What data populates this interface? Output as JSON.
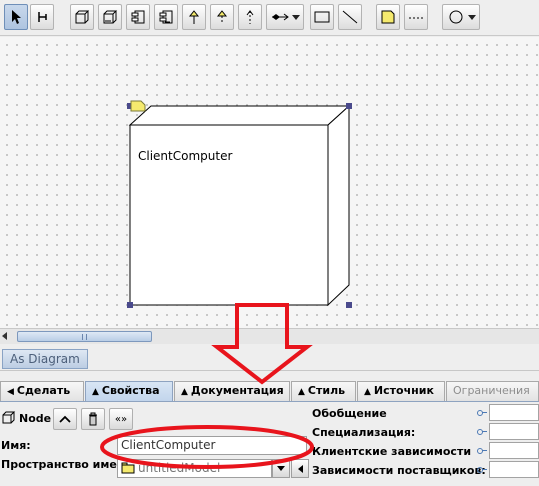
{
  "diagram": {
    "node_name": "ClientComputer"
  },
  "view_tab": {
    "label": "As Diagram"
  },
  "property_tabs": [
    {
      "label": "Сделать",
      "arrow": "◀"
    },
    {
      "label": "Свойства",
      "arrow": "▲"
    },
    {
      "label": "Документация",
      "arrow": "▲"
    },
    {
      "label": "Стиль",
      "arrow": "▲"
    },
    {
      "label": "Источник",
      "arrow": "▲"
    },
    {
      "label": "Ограничения",
      "arrow": ""
    }
  ],
  "properties": {
    "element_type": "Node",
    "name_label": "Имя:",
    "name_value": "ClientComputer",
    "namespace_label": "Пространство имен:",
    "namespace_value": "untitledModel",
    "navigate_label": "«»",
    "right_labels": [
      "Обобщение",
      "Специализация:",
      "Клиентские зависимости",
      "Зависимости поставщиков:"
    ]
  },
  "colors": {
    "annotation_red": "#e8141c",
    "selection_handle": "#4a4a8c",
    "active_tab": "#c2d5ec"
  }
}
